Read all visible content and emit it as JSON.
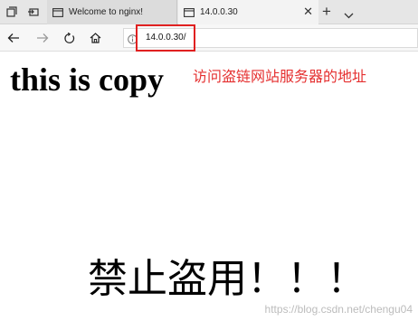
{
  "browser": {
    "tabs": [
      {
        "title": "Welcome to nginx!",
        "active": false
      },
      {
        "title": "14.0.0.30",
        "active": true
      }
    ],
    "close_glyph": "✕",
    "new_tab_glyph": "+",
    "address": "14.0.0.30/"
  },
  "page": {
    "heading": "this is copy",
    "message": "禁止盗用！！！"
  },
  "annotation": {
    "text": "访问盗链网站服务器的地址",
    "color": "#e53030"
  },
  "watermark": "https://blog.csdn.net/chengu04"
}
